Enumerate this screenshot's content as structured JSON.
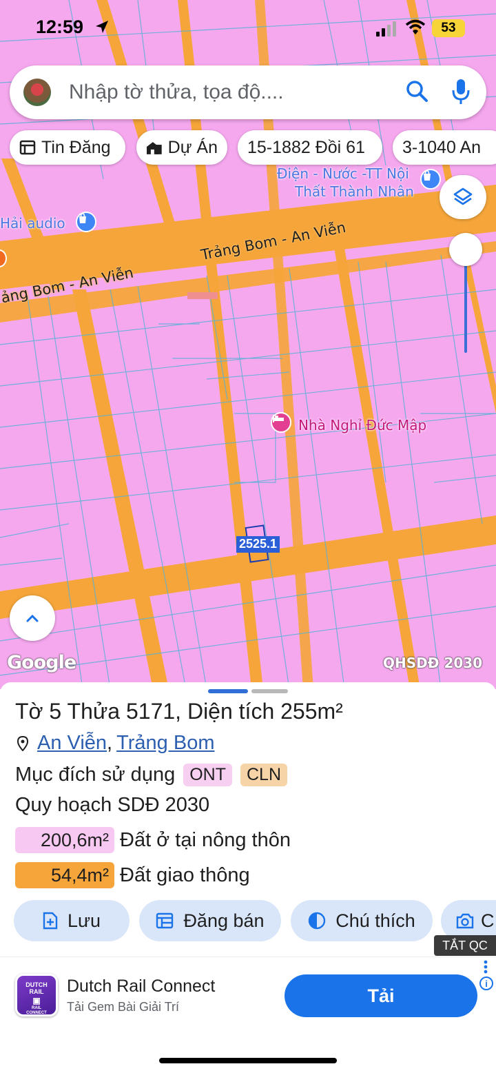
{
  "status_bar": {
    "time": "12:59",
    "battery": "53"
  },
  "search": {
    "placeholder": "Nhập tờ thửa, tọa độ...."
  },
  "chips": [
    "Tin Đăng",
    "Dự Án",
    "15-1882 Đồi 61",
    "3-1040 An"
  ],
  "map": {
    "road_labels": [
      "Trảng Bom - An Viễn",
      "ảng Bom - An Viễn"
    ],
    "poi_labels": [
      "Hải audio",
      "Điện - Nước -TT Nội",
      "Thất Thành Nhân",
      "Nhà Nghỉ Đức Mập"
    ],
    "parcel_label": "25.1",
    "parcel_label_behind": "25",
    "attribution": "Google",
    "layer_name": "QHSDĐ 2030"
  },
  "parcel": {
    "title_prefix": "Tờ",
    "sheet_no": "5",
    "title_mid": "Thửa",
    "plot_no": "5171",
    "title_area_label": ", Diện tích",
    "area": "255m²",
    "ward": "An Viễn",
    "district": "Trảng Bom",
    "purpose_label": "Mục đích sử dụng",
    "purpose_tags": [
      "ONT",
      "CLN"
    ],
    "plan_title": "Quy hoạch SDĐ 2030",
    "plan_items": [
      {
        "area": "200,6m²",
        "label": "Đất ở tại nông thôn",
        "color": "#f7c8f1"
      },
      {
        "area": "54,4m²",
        "label": "Đất giao thông",
        "color": "#f5a53a"
      }
    ]
  },
  "actions": [
    "Lưu",
    "Đăng bán",
    "Chú thích",
    "C"
  ],
  "ad": {
    "close_label": "TẮT QC",
    "icon_text": "DUTCH RAIL",
    "icon_subtext": "RAIL CONNECT",
    "title": "Dutch Rail Connect",
    "subtitle": "Tải Gem Bài Giải Trí",
    "cta": "Tải",
    "info": "i"
  },
  "colors": {
    "map_fill": "#f6a8ef",
    "road": "#f5a53a",
    "accent": "#1a73e8"
  }
}
